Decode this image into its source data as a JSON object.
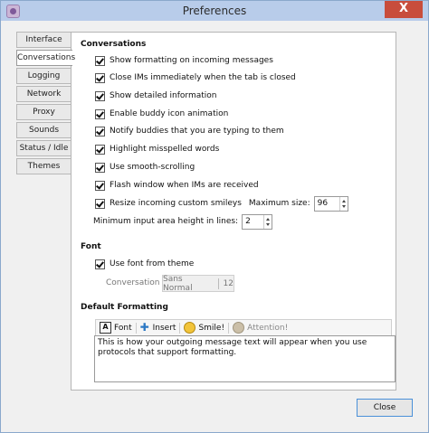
{
  "window": {
    "title": "Preferences",
    "close_glyph": "X"
  },
  "tabs": [
    {
      "label": "Interface"
    },
    {
      "label": "Conversations"
    },
    {
      "label": "Logging"
    },
    {
      "label": "Network"
    },
    {
      "label": "Proxy"
    },
    {
      "label": "Sounds"
    },
    {
      "label": "Status / Idle"
    },
    {
      "label": "Themes"
    }
  ],
  "active_tab": "Conversations",
  "conversations": {
    "heading": "Conversations",
    "options": [
      {
        "label": "Show formatting on incoming messages",
        "checked": true
      },
      {
        "label": "Close IMs immediately when the tab is closed",
        "checked": true
      },
      {
        "label": "Show detailed information",
        "checked": true
      },
      {
        "label": "Enable buddy icon animation",
        "checked": true
      },
      {
        "label": "Notify buddies that you are typing to them",
        "checked": true
      },
      {
        "label": "Highlight misspelled words",
        "checked": true
      },
      {
        "label": "Use smooth-scrolling",
        "checked": true
      },
      {
        "label": "Flash window when IMs are received",
        "checked": true
      }
    ],
    "resize": {
      "label": "Resize incoming custom smileys",
      "checked": true,
      "max_label": "Maximum size:",
      "max_value": "96"
    },
    "min_input": {
      "label": "Minimum input area height in lines:",
      "value": "2"
    }
  },
  "font": {
    "heading": "Font",
    "use_theme_label": "Use font from theme",
    "use_theme_checked": true,
    "conv_font_label": "Conversation font:",
    "font_name": "Sans Normal",
    "font_size": "12"
  },
  "default_formatting": {
    "heading": "Default Formatting",
    "toolbar": [
      {
        "label": "Font",
        "icon": "font-icon"
      },
      {
        "label": "Insert",
        "icon": "plus-icon"
      },
      {
        "label": "Smile!",
        "icon": "smiley-icon"
      },
      {
        "label": "Attention!",
        "icon": "attention-icon",
        "disabled": true
      }
    ],
    "sample_text": "This is how your outgoing message text will appear when you use protocols that support formatting."
  },
  "footer": {
    "close_label": "Close"
  }
}
